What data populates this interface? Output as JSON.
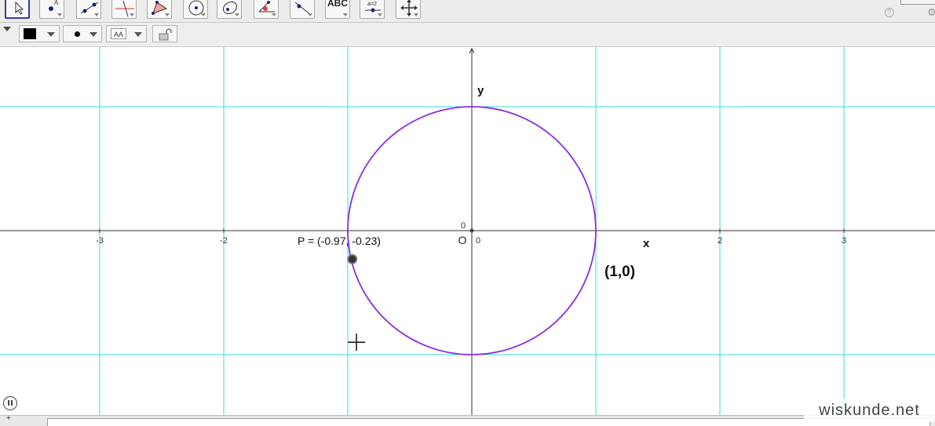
{
  "toolbar": {
    "tools": [
      {
        "name": "move-tool-button",
        "icon": "arrow-pointer-icon",
        "selected": true
      },
      {
        "name": "point-tool-button",
        "icon": "point-icon"
      },
      {
        "name": "line-tool-button",
        "icon": "line-through-two-points-icon"
      },
      {
        "name": "perpendicular-tool-button",
        "icon": "perpendicular-line-icon"
      },
      {
        "name": "polygon-tool-button",
        "icon": "polygon-icon"
      },
      {
        "name": "circle-tool-button",
        "icon": "circle-center-point-icon"
      },
      {
        "name": "conic-tool-button",
        "icon": "ellipse-icon"
      },
      {
        "name": "angle-tool-button",
        "icon": "angle-icon"
      },
      {
        "name": "reflect-tool-button",
        "icon": "reflect-icon"
      },
      {
        "name": "text-tool-button",
        "icon": "text-icon",
        "label": "ABC"
      },
      {
        "name": "slider-tool-button",
        "icon": "slider-icon",
        "label": "a=2"
      },
      {
        "name": "move-view-tool-button",
        "icon": "move-graphics-view-icon"
      }
    ]
  },
  "stylebar": {
    "color": "#000000",
    "font_label": "AA"
  },
  "graphics": {
    "x_ticks": [
      "-3",
      "-2",
      "0",
      "2",
      "3"
    ],
    "y_origin_label": "0",
    "x_axis_label": "x",
    "y_axis_label": "y",
    "origin_label": "O",
    "point_label": "P = (-0.97, -0.23)",
    "point": {
      "x": -0.97,
      "y": -0.23
    },
    "circle": {
      "center_x": 0,
      "center_y": 0,
      "radius": 1
    },
    "annotation": "(1,0)",
    "cursor": {
      "x": -0.93,
      "y": -0.9
    }
  },
  "colors": {
    "grid": "#32e0e0",
    "axes": "#333333",
    "circle": "#8a2be2",
    "point": "#333333"
  },
  "input_bar": {
    "label": "+"
  },
  "watermark": "wiskunde.net"
}
